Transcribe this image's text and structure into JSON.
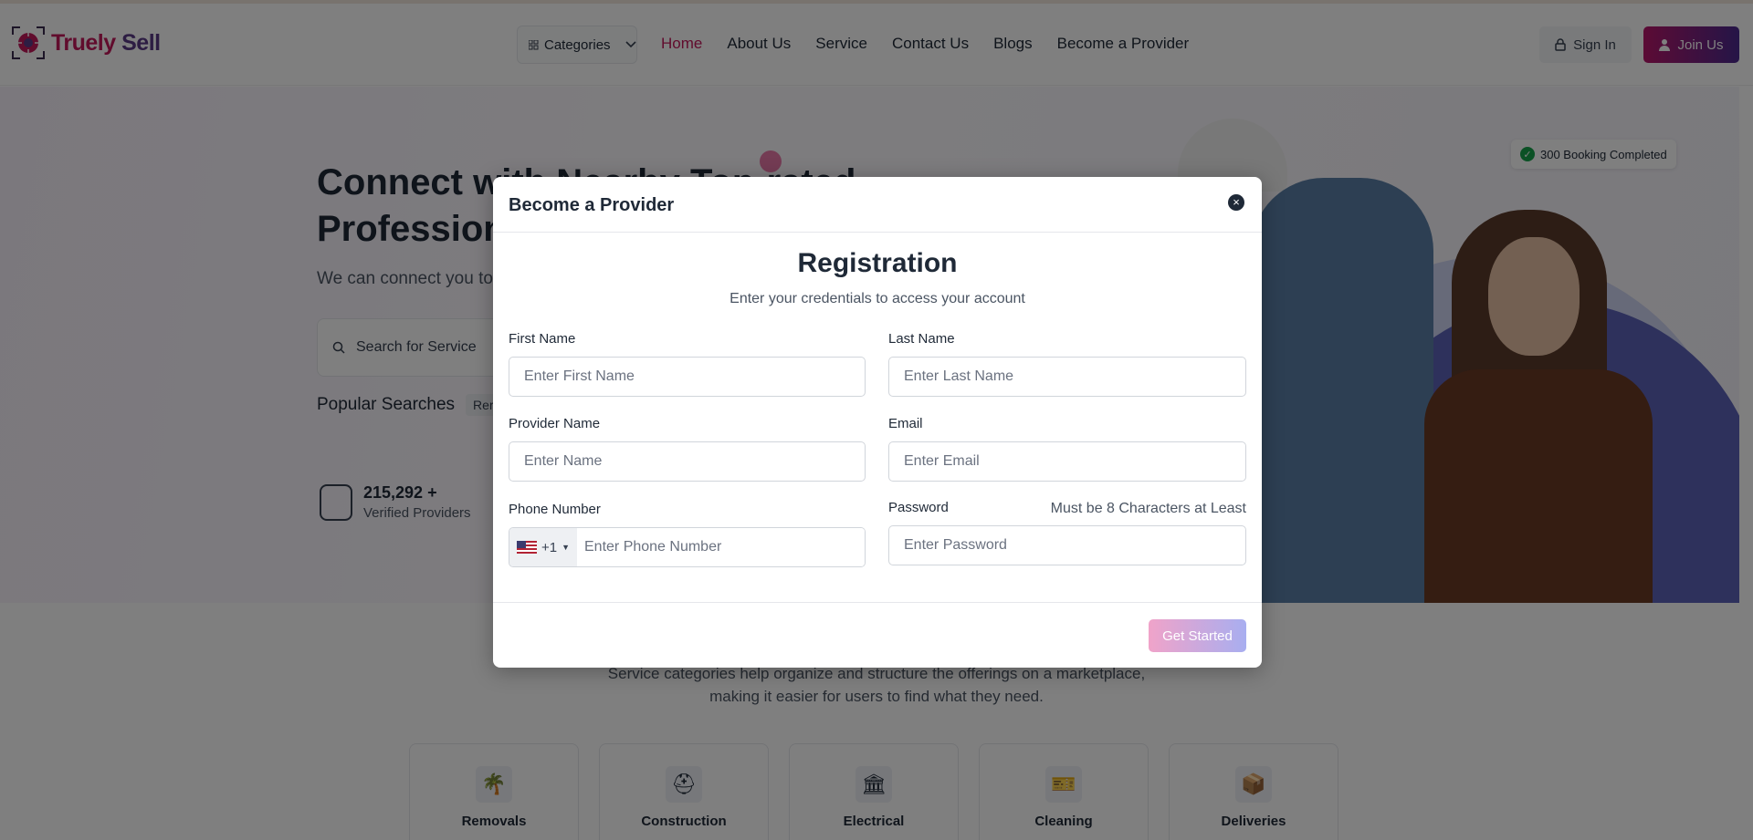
{
  "header": {
    "logo_text_a": "Truely",
    "logo_text_b": "Sell",
    "categories_label": "Categories",
    "nav": [
      "Home",
      "About Us",
      "Service",
      "Contact Us",
      "Blogs",
      "Become a Provider"
    ],
    "active_nav": "Home",
    "sign_in": "Sign In",
    "join_us": "Join Us"
  },
  "hero": {
    "title": "Connect with Nearby Top-rated Professionals",
    "subtitle": "We can connect you to",
    "search_placeholder": "Search for Service",
    "popular_label": "Popular Searches",
    "popular_pill": "Rer",
    "stat_value": "215,292 +",
    "stat_label": "Verified Providers",
    "badge": "300 Booking Completed"
  },
  "categories_section": {
    "description": "Service categories help organize and structure the offerings on a marketplace, making it easier for users to find what they need.",
    "cards": [
      {
        "label": "Removals",
        "icon": "palm-tree-icon"
      },
      {
        "label": "Construction",
        "icon": "helmet-icon"
      },
      {
        "label": "Electrical",
        "icon": "building-icon"
      },
      {
        "label": "Cleaning",
        "icon": "ticket-icon"
      },
      {
        "label": "Deliveries",
        "icon": "delivery-person-icon"
      }
    ]
  },
  "modal": {
    "title": "Become a Provider",
    "heading": "Registration",
    "subheading": "Enter your credentials to access your account",
    "first_name_label": "First Name",
    "first_name_placeholder": "Enter First Name",
    "last_name_label": "Last Name",
    "last_name_placeholder": "Enter Last Name",
    "provider_name_label": "Provider Name",
    "provider_name_placeholder": "Enter Name",
    "email_label": "Email",
    "email_placeholder": "Enter Email",
    "phone_label": "Phone Number",
    "country_code": "+1",
    "phone_placeholder": "Enter Phone Number",
    "password_label": "Password",
    "password_hint": "Must be 8 Characters at Least",
    "password_placeholder": "Enter Password",
    "submit": "Get Started"
  },
  "colors": {
    "brand": "#c2185b",
    "brand_secondary": "#4a2a8f",
    "overlay": "rgba(0,0,0,0.5)"
  }
}
